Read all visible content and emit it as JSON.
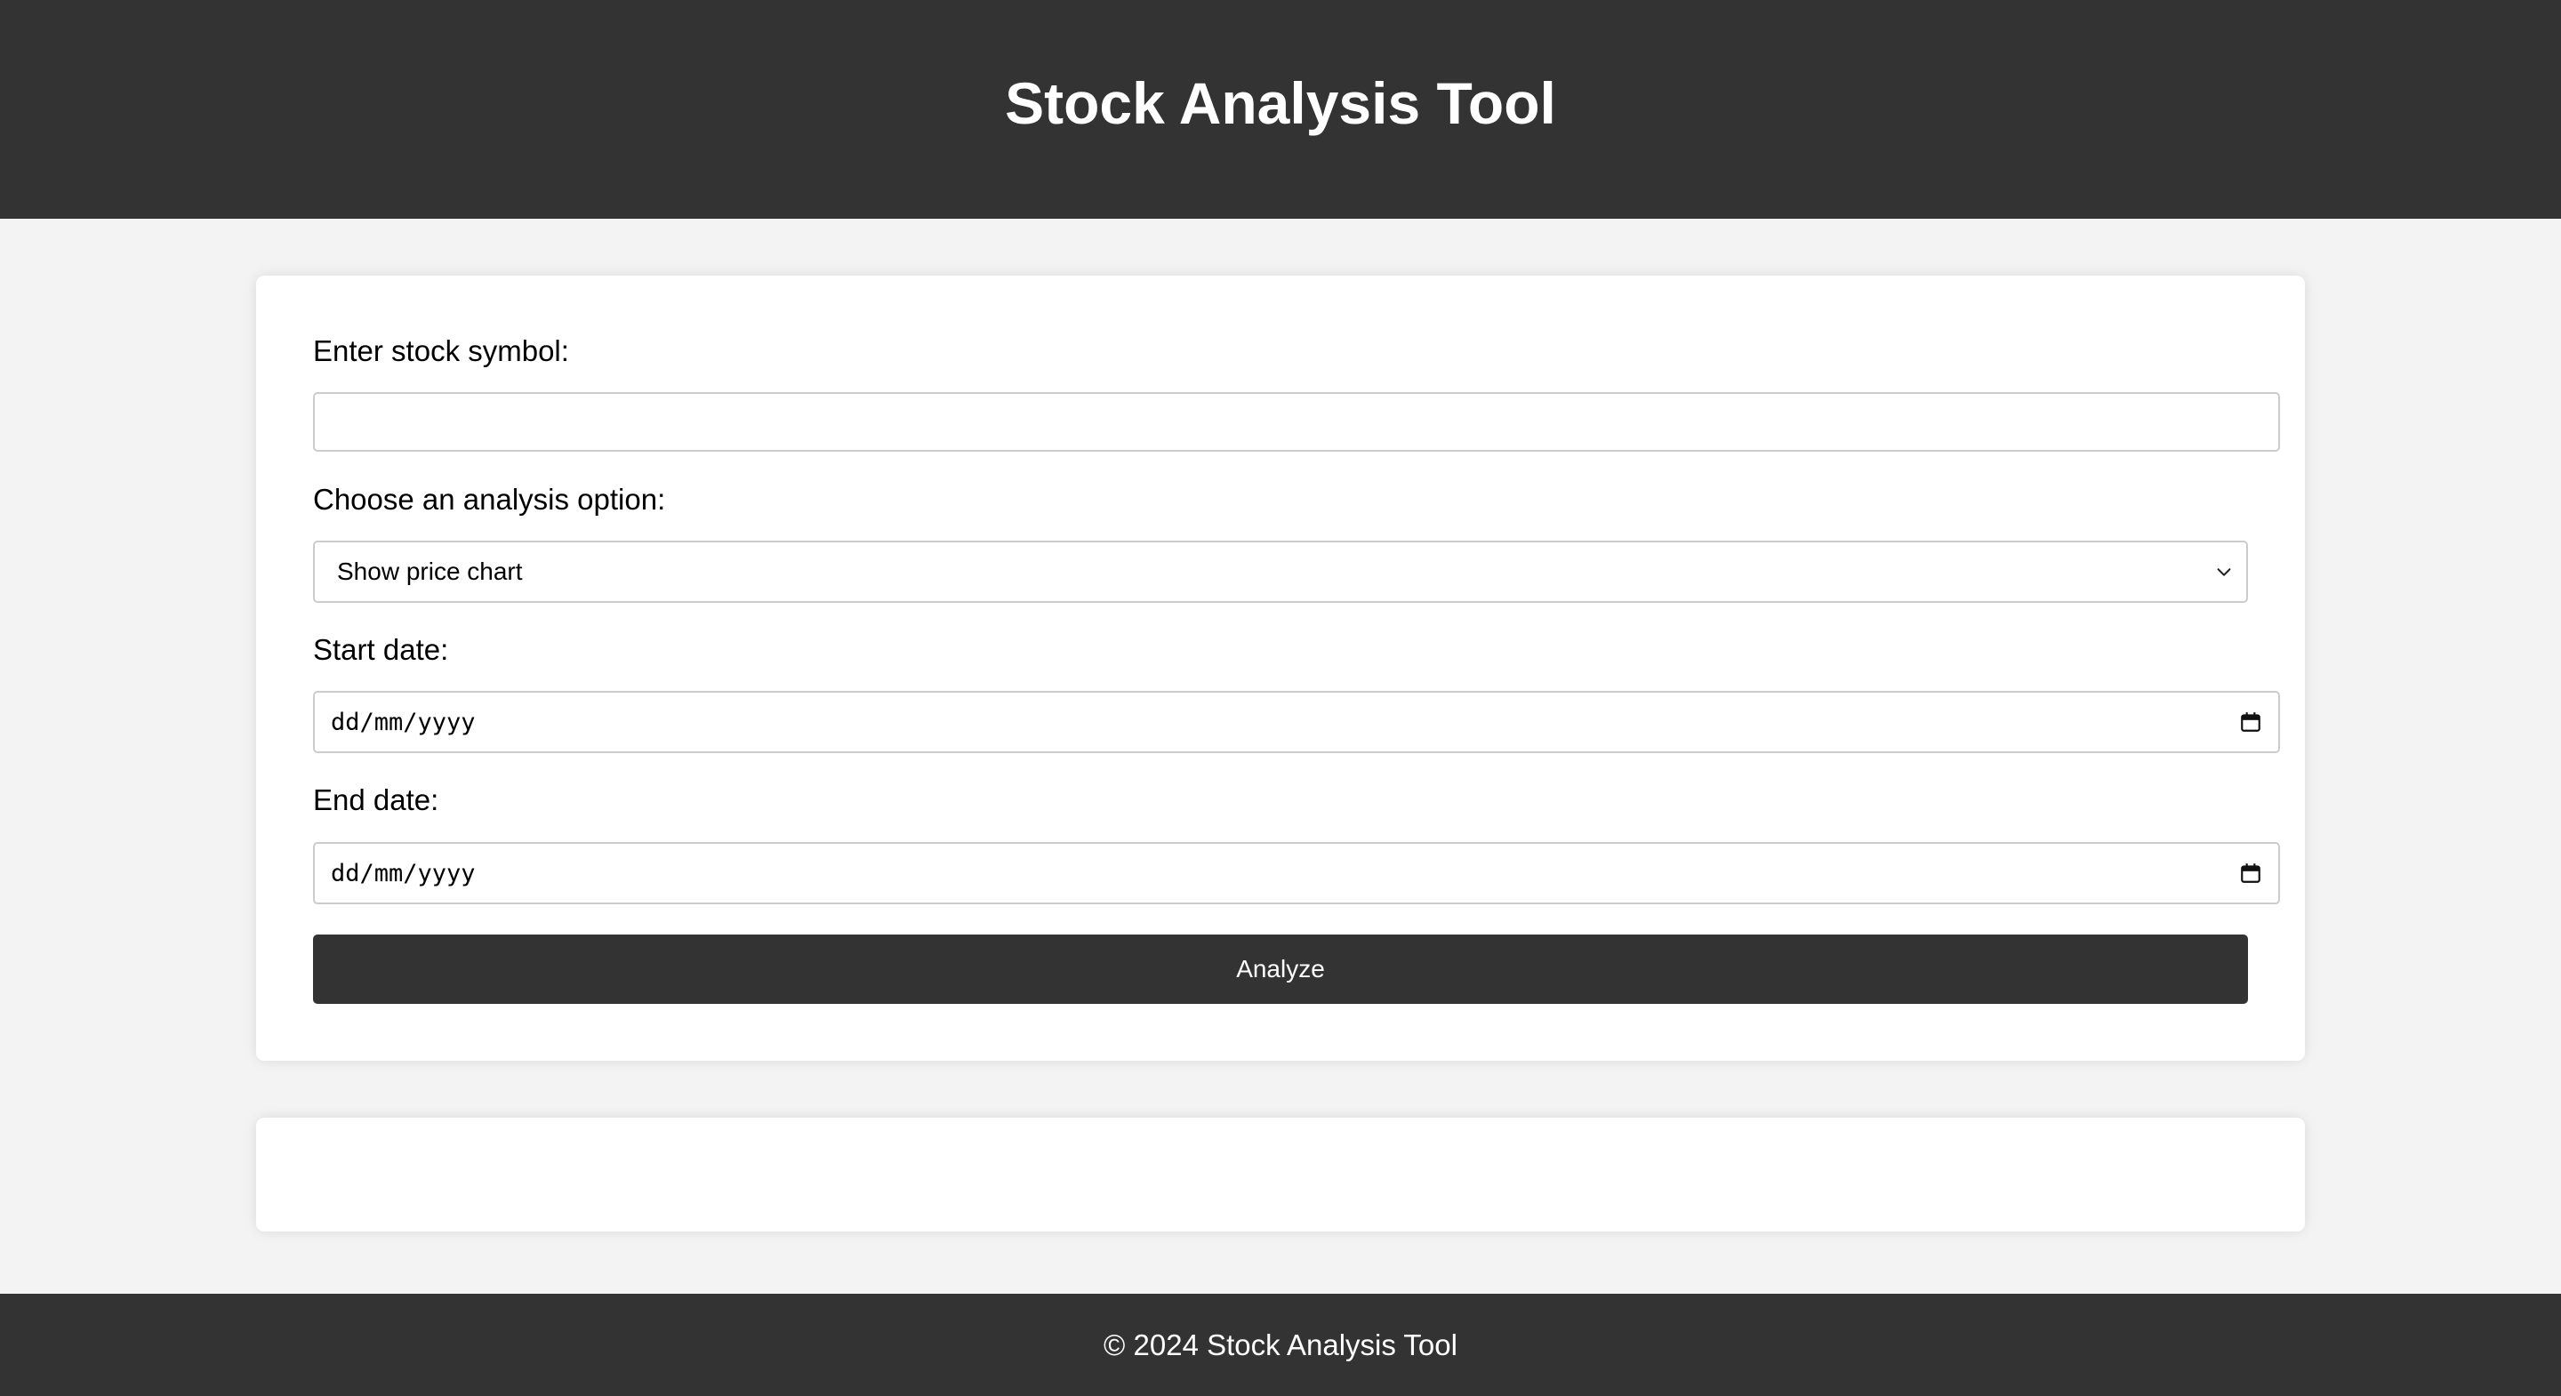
{
  "header": {
    "title": "Stock Analysis Tool"
  },
  "form": {
    "symbol_label": "Enter stock symbol:",
    "symbol_value": "",
    "option_label": "Choose an analysis option:",
    "option_selected": "Show price chart",
    "start_label": "Start date:",
    "start_value": "dd/mm/yyyy",
    "end_label": "End date:",
    "end_value": "dd/mm/yyyy",
    "submit_label": "Analyze"
  },
  "icons": {
    "select_arrow": "chevron-down-icon",
    "date_picker": "calendar-icon"
  },
  "colors": {
    "header_bg": "#333333",
    "page_bg": "#f3f3f3",
    "button_bg": "#333333"
  },
  "footer": {
    "text": "© 2024 Stock Analysis Tool"
  }
}
